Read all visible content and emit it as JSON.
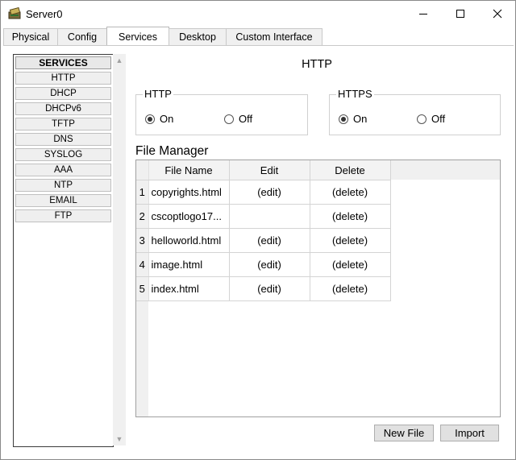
{
  "window": {
    "title": "Server0"
  },
  "tabs": [
    "Physical",
    "Config",
    "Services",
    "Desktop",
    "Custom Interface"
  ],
  "sidebar": {
    "header": "SERVICES",
    "items": [
      "HTTP",
      "DHCP",
      "DHCPv6",
      "TFTP",
      "DNS",
      "SYSLOG",
      "AAA",
      "NTP",
      "EMAIL",
      "FTP"
    ]
  },
  "main": {
    "title": "HTTP",
    "http": {
      "label": "HTTP",
      "on": "On",
      "off": "Off",
      "selected": "On"
    },
    "https": {
      "label": "HTTPS",
      "on": "On",
      "off": "Off",
      "selected": "On"
    },
    "file_manager": {
      "title": "File Manager",
      "columns": [
        "File Name",
        "Edit",
        "Delete"
      ],
      "rows": [
        {
          "index": "1",
          "name": "copyrights.html",
          "edit": "(edit)",
          "delete": "(delete)"
        },
        {
          "index": "2",
          "name": "cscoptlogo17...",
          "edit": "",
          "delete": "(delete)"
        },
        {
          "index": "3",
          "name": "helloworld.html",
          "edit": "(edit)",
          "delete": "(delete)"
        },
        {
          "index": "4",
          "name": "image.html",
          "edit": "(edit)",
          "delete": "(delete)"
        },
        {
          "index": "5",
          "name": "index.html",
          "edit": "(edit)",
          "delete": "(delete)"
        }
      ]
    },
    "buttons": {
      "new_file": "New File",
      "import": "Import"
    }
  }
}
